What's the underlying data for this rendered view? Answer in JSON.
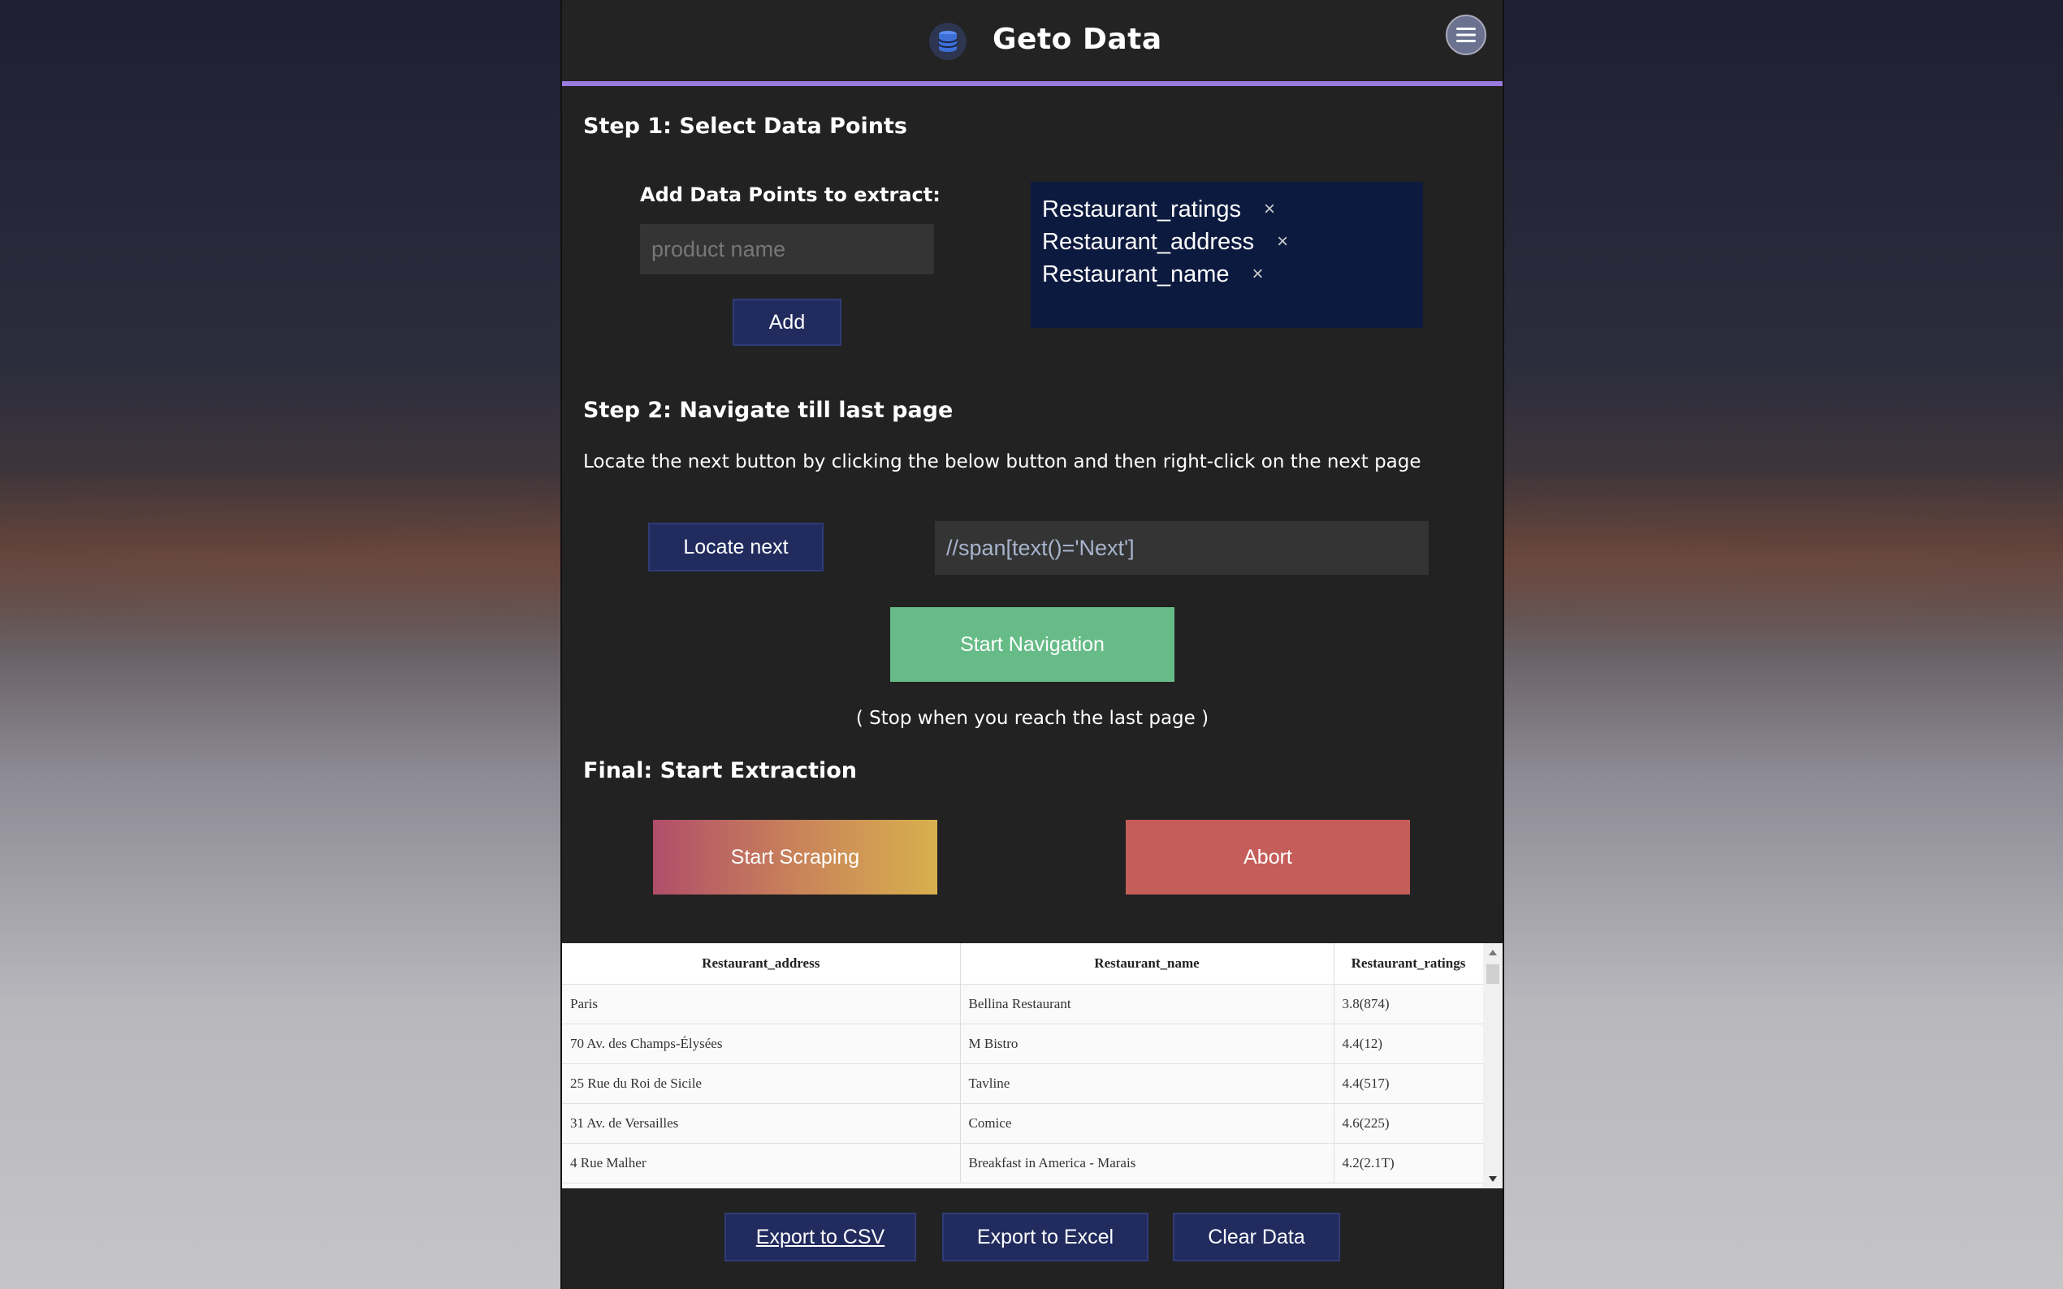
{
  "app": {
    "title": "Geto Data",
    "logo_icon": "database-icon",
    "menu_icon": "hamburger-menu-icon"
  },
  "step1": {
    "title": "Step 1: Select Data Points",
    "label": "Add Data Points to extract:",
    "placeholder": "product name",
    "add_label": "Add",
    "tags": [
      "Restaurant_ratings",
      "Restaurant_address",
      "Restaurant_name"
    ],
    "remove_glyph": "×"
  },
  "step2": {
    "title": "Step 2: Navigate till last page",
    "description": "Locate the next button by clicking the below button and then right-click on the next page",
    "locate_label": "Locate next",
    "xpath_value": "//span[text()='Next']",
    "start_nav_label": "Start Navigation",
    "hint": "( Stop when you reach the last page )"
  },
  "final": {
    "title": "Final: Start Extraction",
    "start_label": "Start Scraping",
    "abort_label": "Abort"
  },
  "table": {
    "headers": [
      "Restaurant_address",
      "Restaurant_name",
      "Restaurant_ratings"
    ],
    "rows": [
      [
        "Paris",
        "Bellina Restaurant",
        "3.8(874)"
      ],
      [
        "70 Av. des Champs-Élysées",
        "M Bistro",
        "4.4(12)"
      ],
      [
        "25 Rue du Roi de Sicile",
        "Tavline",
        "4.4(517)"
      ],
      [
        "31 Av. de Versailles",
        "Comice",
        "4.6(225)"
      ],
      [
        "4 Rue Malher",
        "Breakfast in America - Marais",
        "4.2(2.1T)"
      ]
    ]
  },
  "footer": {
    "export_csv": "Export to CSV",
    "export_excel": "Export to Excel",
    "clear": "Clear Data"
  },
  "colors": {
    "accent": "#9b7be0",
    "navy": "#212b5e",
    "green": "#66bb87",
    "abort": "#c55e5a"
  }
}
